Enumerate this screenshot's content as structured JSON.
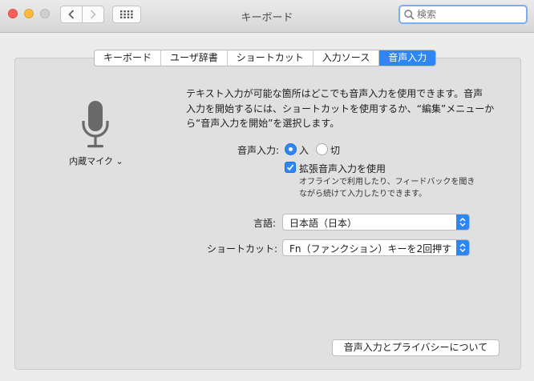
{
  "window": {
    "title": "キーボード"
  },
  "search": {
    "value": "",
    "placeholder": "検索"
  },
  "tabs": [
    {
      "label": "キーボード"
    },
    {
      "label": "ユーザ辞書"
    },
    {
      "label": "ショートカット"
    },
    {
      "label": "入力ソース"
    },
    {
      "label": "音声入力",
      "active": true
    }
  ],
  "mic": {
    "label": "内蔵マイク ⌄",
    "icon": "microphone-icon"
  },
  "description": "テキスト入力が可能な箇所はどこでも音声入力を使用できます。音声\n入力を開始するには、ショートカットを使用するか、“編集”メニューか\nら“音声入力を開始”を選択します。",
  "dictation": {
    "label": "音声入力:",
    "on_label": "入",
    "off_label": "切",
    "selected": "入"
  },
  "enhanced": {
    "label": "拡張音声入力を使用",
    "checked": true,
    "note": "オフラインで利用したり、フィードバックを聞き\nながら続けて入力したりできます。"
  },
  "language": {
    "label": "言語:",
    "value": "日本語（日本）"
  },
  "shortcut": {
    "label": "ショートカット:",
    "value": "Fn（ファンクション）キーを2回押す"
  },
  "privacy_button": "音声入力とプライバシーについて",
  "colors": {
    "accent": "#2d86f3",
    "close": "#fc605b",
    "minimize": "#fdbc40"
  }
}
